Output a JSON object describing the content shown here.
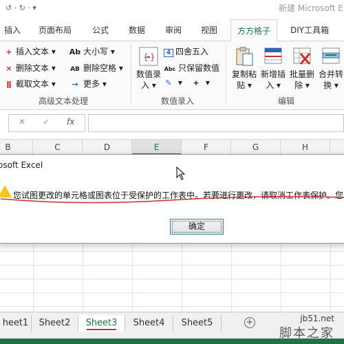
{
  "window": {
    "title": "新建 Microsoft E",
    "qat": "↺ · ↻ ·   ▾"
  },
  "ribbon_tabs": [
    "插入",
    "页面布局",
    "公式",
    "数据",
    "审阅",
    "视图",
    "方方格子",
    "DIY工具箱"
  ],
  "active_tab": "方方格子",
  "groups": {
    "text": {
      "label": "高级文本处理",
      "insert_text": "插入文本",
      "delete_text": "删除文本",
      "extract_text": "截取文本",
      "case": "大小写",
      "delete_spaces": "删除空格",
      "more": "更多",
      "ic_insert": "+",
      "ic_delete": "×",
      "ic_extract": "ǁ",
      "ic_case": "Ab",
      "ic_delspace": "AB",
      "ic_more": "→"
    },
    "entry": {
      "label": "数值录入",
      "number_entry_1": "数值录",
      "number_entry_2": "入",
      "round": "四舍五入",
      "keep_values": "只保留数值",
      "ic_round": "4",
      "ic_keep": "Abc",
      "ic_plus": "+"
    },
    "edit": {
      "label": "编辑",
      "copy_paste_1": "复制粘",
      "copy_paste_2": "贴",
      "new_insert_1": "新增插",
      "new_insert_2": "入",
      "batch_delete_1": "批量删",
      "batch_delete_2": "除",
      "merge_convert_1": "合并转",
      "merge_convert_2": "换"
    }
  },
  "formula_bar": {
    "cancel": "✕",
    "confirm": "✓",
    "fx": "fx",
    "value": ""
  },
  "columns": [
    "B",
    "C",
    "D",
    "E",
    "F",
    "G",
    "H"
  ],
  "selected_column": "E",
  "dialog": {
    "title": "osoft Excel",
    "message": "您试图更改的单元格或图表位于受保护的工作表中。若要进行更改，请取消工作表保护。您",
    "ok": "确定"
  },
  "sheets": [
    "heet1",
    "Sheet2",
    "Sheet3",
    "Sheet4",
    "Sheet5"
  ],
  "active_sheet": "Sheet3",
  "add_sheet": "+",
  "watermark": {
    "line1": "jb51.net",
    "line2": "脚本之家"
  },
  "colors": {
    "excel_green": "#217346",
    "annotation_red": "#c8302a",
    "warning_yellow": "#f5c518"
  }
}
